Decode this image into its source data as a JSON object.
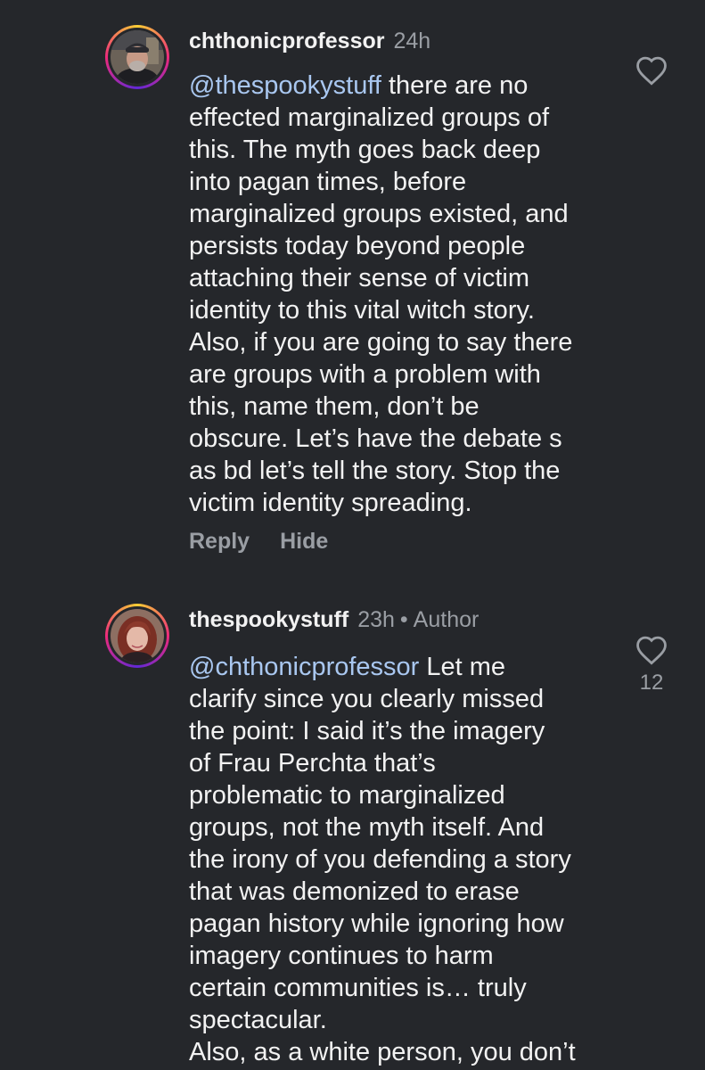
{
  "comments": [
    {
      "username": "chthonicprofessor",
      "time": "24h",
      "mention": "@thespookystuff",
      "lines": [
        " there are no",
        "effected marginalized groups of",
        "this. The myth goes back deep",
        "into pagan times, before",
        "marginalized groups existed, and",
        "persists today beyond people",
        "attaching their sense of victim",
        "identity to this vital witch story.",
        "Also, if you are going to say there",
        "are groups with a problem with",
        "this, name them, don’t be",
        "obscure. Let’s have the debate s",
        "as bd let’s tell the story. Stop the",
        "victim identity spreading."
      ],
      "reply_label": "Reply",
      "hide_label": "Hide",
      "like_icon": "heart-outline-icon"
    },
    {
      "username": "thespookystuff",
      "time": "23h",
      "separator": "•",
      "author_badge": "Author",
      "mention": "@chthonicprofessor",
      "lines": [
        " Let me",
        "clarify since you clearly missed",
        "the point: I said it’s the imagery",
        "of Frau Perchta that’s",
        "problematic to marginalized",
        "groups, not the myth itself. And",
        "the irony of you defending a story",
        "that was demonized to erase",
        "pagan history while ignoring how",
        "imagery continues to harm",
        "certain communities is… truly",
        "spectacular.",
        "Also, as a white person, you don’t"
      ],
      "like_count": "12",
      "like_icon": "heart-outline-icon"
    }
  ],
  "colors": {
    "background": "#25272b",
    "text": "#f2f2f2",
    "secondary": "#9a9ea4",
    "mention": "#a9c7f0"
  }
}
